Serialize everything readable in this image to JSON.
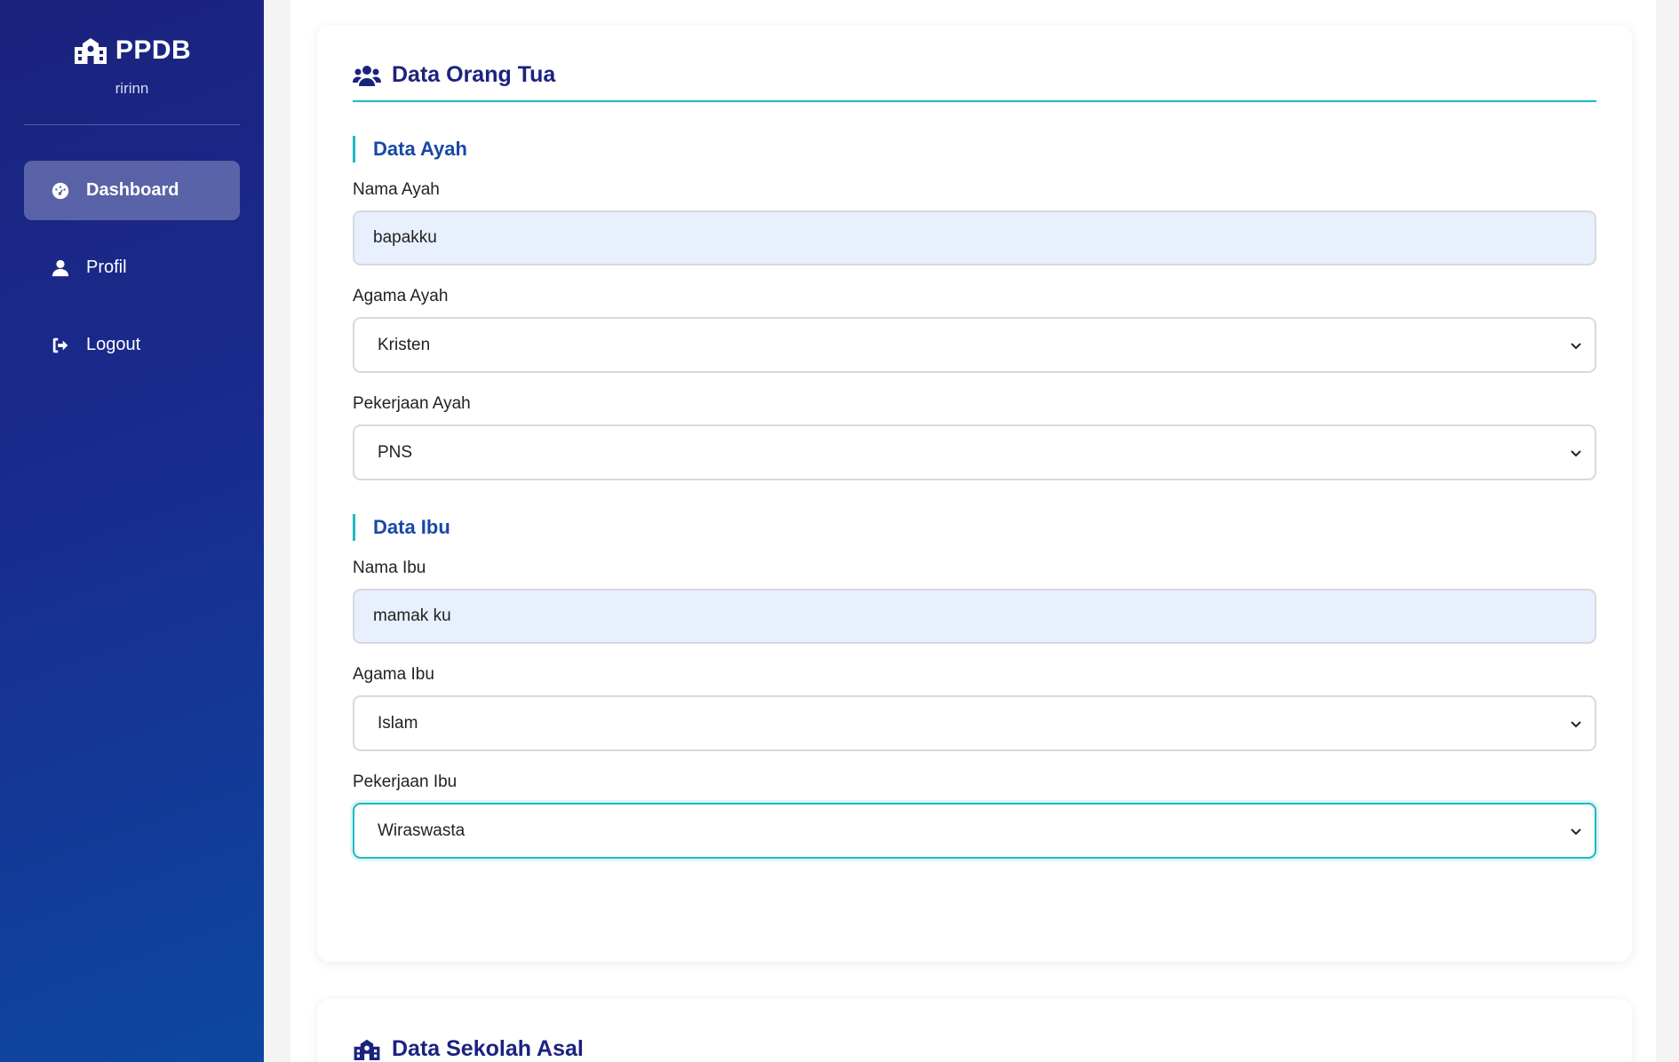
{
  "sidebar": {
    "brand": "PPDB",
    "username": "ririnn",
    "items": [
      {
        "label": "Dashboard",
        "icon": "dashboard-icon",
        "active": true
      },
      {
        "label": "Profil",
        "icon": "user-icon",
        "active": false
      },
      {
        "label": "Logout",
        "icon": "logout-icon",
        "active": false
      }
    ]
  },
  "parents_card": {
    "title": "Data Orang Tua",
    "father": {
      "section_title": "Data Ayah",
      "name_label": "Nama Ayah",
      "name_value": "bapakku",
      "religion_label": "Agama Ayah",
      "religion_value": "Kristen",
      "job_label": "Pekerjaan Ayah",
      "job_value": "PNS"
    },
    "mother": {
      "section_title": "Data Ibu",
      "name_label": "Nama Ibu",
      "name_value": "mamak ku",
      "religion_label": "Agama Ibu",
      "religion_value": "Islam",
      "job_label": "Pekerjaan Ibu",
      "job_value": "Wiraswasta"
    }
  },
  "school_card": {
    "title": "Data Sekolah Asal"
  },
  "colors": {
    "sidebar_top": "#1a237e",
    "sidebar_bottom": "#0d47a1",
    "accent": "#1db9c3",
    "heading": "#1a237e",
    "section": "#1948a6",
    "input_fill": "#e8f0fe"
  }
}
